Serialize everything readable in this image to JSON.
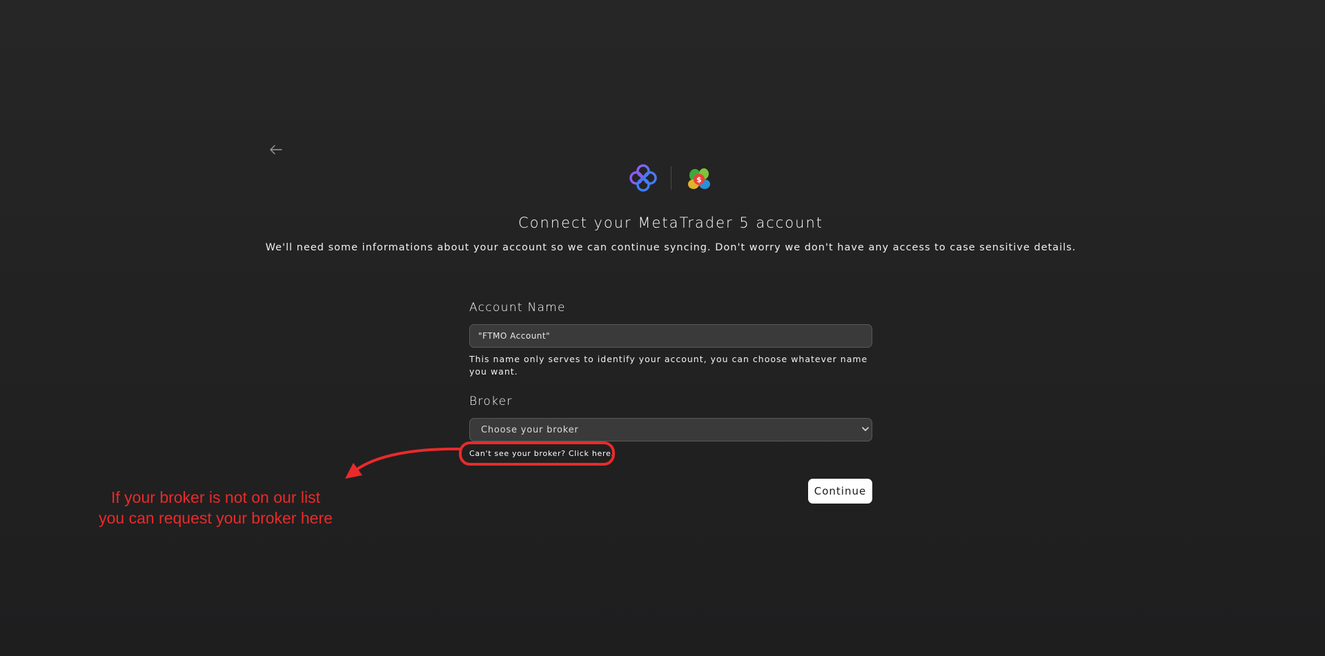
{
  "page": {
    "title": "Connect your MetaTrader 5 account",
    "subtitle": "We'll need some informations about your account so we can continue syncing. Don't worry we don't have any access to case sensitive details."
  },
  "icons": {
    "back": "arrow-left-icon",
    "app_logo": "app-logo",
    "metatrader_logo": "metatrader5-logo",
    "select_chevron": "chevron-down-icon"
  },
  "form": {
    "account_name": {
      "label": "Account Name",
      "placeholder": "\"FTMO Account\"",
      "help": "This name only serves to identify your account, you can choose whatever name you want."
    },
    "broker": {
      "label": "Broker",
      "selected": "Choose your broker",
      "link": "Can't see your broker? Click here."
    },
    "continue_label": "Continue"
  },
  "annotation": {
    "line1": "If your broker is not on our list",
    "line2": "you can request your broker here"
  },
  "colors": {
    "background": "#232324",
    "input_bg": "#3a3a3b",
    "annotation_red": "#ea2a2a",
    "logo_purple": "#7a5cf0",
    "logo_blue": "#3d7ef5"
  }
}
